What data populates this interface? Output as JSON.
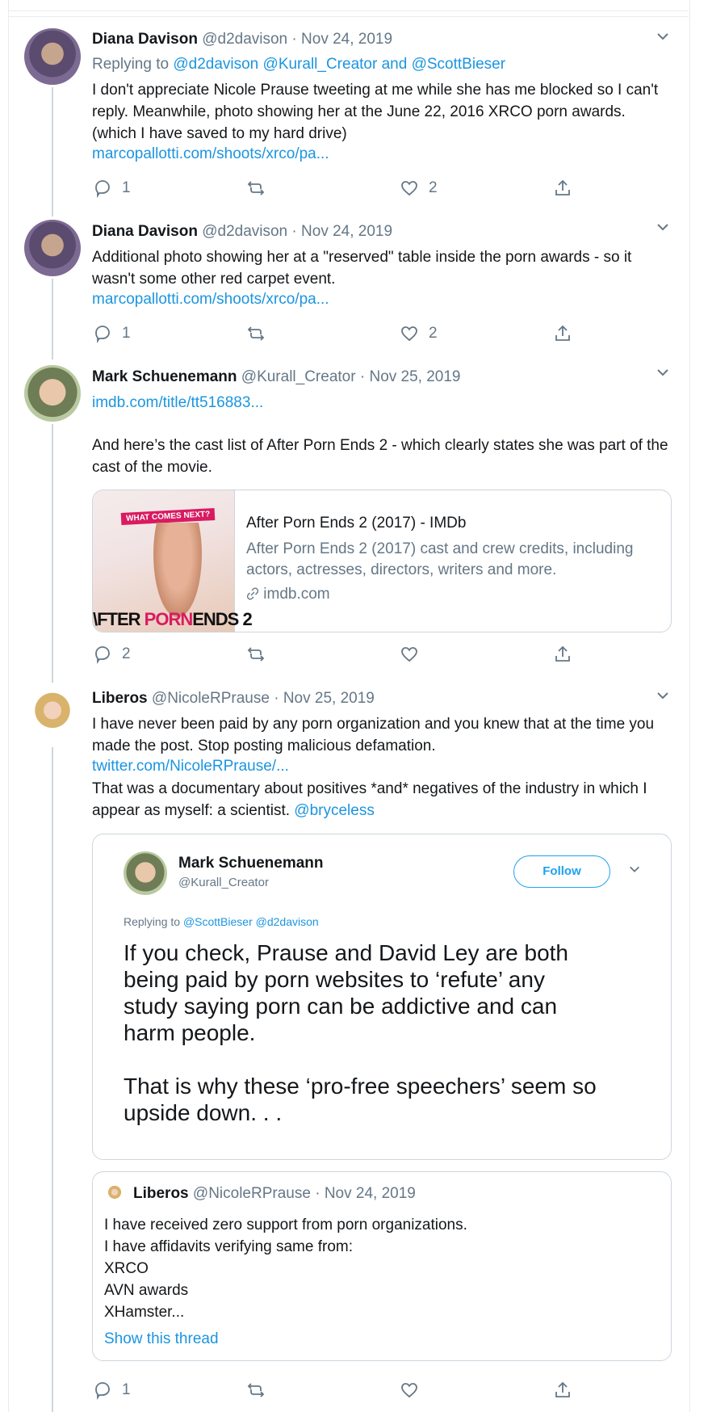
{
  "tweets": [
    {
      "name": "Diana Davison",
      "handle": "@d2davison",
      "sep": "·",
      "date": "Nov 24, 2019",
      "reply_prefix": "Replying to",
      "reply_users": "@d2davison @Kurall_Creator",
      "reply_and": "and",
      "reply_last": "@ScottBieser",
      "text": "I don't appreciate Nicole Prause tweeting at me while she has me blocked so I can't reply. Meanwhile, photo showing her at the June 22, 2016 XRCO porn awards. (which I have saved to my hard drive)",
      "link": "marcopallotti.com/shoots/xrco/pa...",
      "replies": "1",
      "retweets": "",
      "likes": "2"
    },
    {
      "name": "Diana Davison",
      "handle": "@d2davison",
      "sep": "·",
      "date": "Nov 24, 2019",
      "text": "Additional photo showing her at a \"reserved\" table inside the porn awards - so it wasn't some other red carpet event.",
      "link": "marcopallotti.com/shoots/xrco/pa...",
      "replies": "1",
      "retweets": "",
      "likes": "2"
    },
    {
      "name": "Mark Schuenemann",
      "handle": "@Kurall_Creator",
      "sep": "·",
      "date": "Nov 25, 2019",
      "link": "imdb.com/title/tt516883...",
      "text": "And here’s the cast list of After Porn Ends 2 - which clearly states she was part of the cast of the movie.",
      "card": {
        "thumb_tag": "WHAT COMES NEXT?",
        "thumb_title_a": "\\FTER ",
        "thumb_title_b": "PORN",
        "thumb_title_c": "ENDS 2",
        "title": "After Porn Ends 2 (2017) - IMDb",
        "description": "After Porn Ends 2 (2017) cast and crew credits, including actors, actresses, directors, writers and more.",
        "domain": "imdb.com"
      },
      "replies": "2",
      "retweets": "",
      "likes": ""
    },
    {
      "name": "Liberos",
      "handle": "@NicoleRPrause",
      "sep": "·",
      "date": "Nov 25, 2019",
      "text1": "I have never been paid by any porn organization and you knew that at the time you made the post. Stop posting malicious defamation.",
      "link": "twitter.com/NicoleRPrause/...",
      "text2": "That was a documentary about positives *and* negatives of the industry in which I appear as myself: a scientist.",
      "mention": "@bryceless",
      "embed": {
        "name": "Mark Schuenemann",
        "handle": "@Kurall_Creator",
        "follow": "Follow",
        "reply_prefix": "Replying to",
        "reply_users": "@ScottBieser @d2davison",
        "text1": "If you check, Prause and David Ley are both being paid by porn websites to ‘refute’ any study saying porn can be addictive and can harm people.",
        "text2": "That is why these ‘pro-free speechers’ seem so upside down. . ."
      },
      "quote": {
        "name": "Liberos",
        "handle": "@NicoleRPrause",
        "sep": "·",
        "date": "Nov 24, 2019",
        "line1": "I have received zero support from porn organizations.",
        "line2": "I have affidavits verifying same from:",
        "line3": "XRCO",
        "line4": "AVN awards",
        "line5": "XHamster...",
        "show_thread": "Show this thread"
      },
      "replies": "1",
      "retweets": "",
      "likes": ""
    }
  ],
  "icons": {
    "reply": "reply-icon",
    "retweet": "retweet-icon",
    "like": "heart-icon",
    "share": "share-icon",
    "more": "chevron-down-icon"
  },
  "colors": {
    "link": "#1b95e0",
    "muted": "#657786",
    "border": "#ccd6dd"
  }
}
